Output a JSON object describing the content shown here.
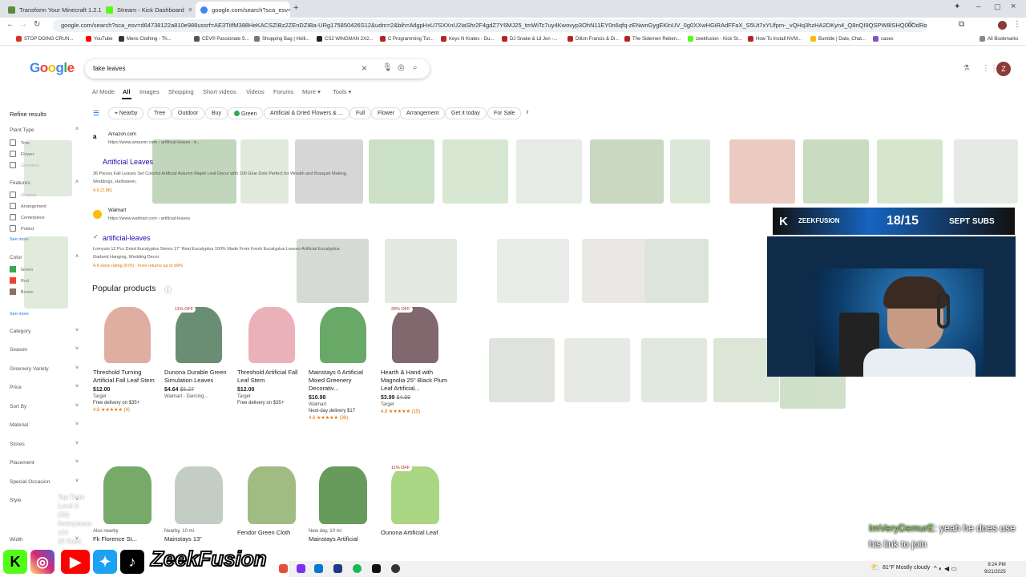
{
  "tabs": [
    {
      "title": "Transform Your Minecraft 1.2.1",
      "color": "#5b8c3a"
    },
    {
      "title": "Stream - Kick Dashboard",
      "color": "#53fc18"
    },
    {
      "title": "google.com/search?sca_esv=6",
      "color": "#4285f4"
    }
  ],
  "address": "google.com/search?sca_esv=d64738122a810e988ussrf=AE3TiIfM388HeKACSZIBz2ZEnDZIBa-URg175850426S12&udm=2&bih=AtlgpHxU7SXXnU2IaShr2F4gdZ7Y6MJ25_tmWiTc7uy4Kwovyp3OhN11EY0n6qfq-zENwnGygEKlnUV_0g0XXwHGiRAdFFaX_S5Ut7xYUfpm-_vQHq3hzHA2DKyn4_Q8nQI9QSPW8lSHQ00OdRq6rbhOAHpaPYKwplRXX",
  "bookmarks": [
    "STOP DOING CRUN...",
    "YouTube",
    "Mens Clothing - Th...",
    "CEV® Passionate S...",
    "Shopping Bag | Holli...",
    "CS2 WINGMAN 2X2...",
    "C Programming Tut...",
    "Keys N Krates - Du...",
    "DJ Snake & Lil Jon -...",
    "Dillon Francis & Di...",
    "The Sidemen Reben...",
    "zeekfusion - Kick St...",
    "How To Install NVM...",
    "Bumble | Date, Chat...",
    "cases",
    "All Bookmarks"
  ],
  "search": {
    "query": "fake leaves",
    "logo": "Google"
  },
  "search_tabs": [
    "AI Mode",
    "All",
    "Images",
    "Shopping",
    "Short videos",
    "Videos",
    "Forums",
    "More",
    "Tools"
  ],
  "chips": [
    "Nearby",
    "Tree",
    "Outdoor",
    "Buy",
    "Green",
    "Artificial & Dried Flowers & ...",
    "Full",
    "Flower",
    "Arrangement",
    "Get it today",
    "For Sale"
  ],
  "sidebar": {
    "title": "Refine results",
    "plant_type": "Plant Type",
    "plant_types": [
      "Tree",
      "Flower",
      "Greenery"
    ],
    "features": "Features",
    "feature_items": [
      "Outdoor",
      "Arrangement",
      "Centerpiece",
      "Potted"
    ],
    "see_more": "See more",
    "color": "Color",
    "colors": [
      {
        "name": "Green",
        "hex": "#34a853"
      },
      {
        "name": "Red",
        "hex": "#ea4335"
      },
      {
        "name": "Brown",
        "hex": "#8d6e63"
      }
    ],
    "see_more2": "See more",
    "sections": [
      "Category",
      "Season",
      "Greenery Variety",
      "Price",
      "Sort By",
      "Material",
      "Stores",
      "Placement",
      "Special Occasion",
      "Style",
      "Width"
    ]
  },
  "results": [
    {
      "source": "Amazon.com",
      "url": "https://www.amazon.com › artificial-leaves › b...",
      "title": "Artificial Leaves",
      "snippet": "36 Pieces Fall Leaves Set Colorful Artificial Autumn Maple Leaf Decor with 100 Glue Dots Perfect for Wreath and Bouquet Making, Weddings, Halloween,",
      "rating": "4.6 (2.9K)"
    },
    {
      "source": "Walmart",
      "url": "https://www.walmart.com › artificial-leaves",
      "title": "artificial-leaves",
      "snippet": "Lomyuio 12 Pcs Dried Eucalyptus Stems 17\" Real Eucalyptus 100% Made From Fresh Eucalyptus Leaves Artificial Eucalyptus Garland Hanging, Wedding Decor",
      "rating": "4.6 store rating (675) · Free returns up to 90%"
    }
  ],
  "popular": {
    "title": "Popular products",
    "items": [
      {
        "badge": "",
        "name": "Threshold Turning Artificial Fall Leaf Stem",
        "price": "$12.00",
        "old": "",
        "store": "Target",
        "extra": "Free delivery on $35+",
        "rating": "4.8 ★★★★★ (4)"
      },
      {
        "badge": "11% OFF",
        "name": "Dunona Durable Green Simulation Leaves",
        "price": "$4.64",
        "old": "$5.27",
        "store": "Walmart - Dancing...",
        "extra": "",
        "rating": ""
      },
      {
        "badge": "",
        "name": "Threshold Artificial Fall Leaf Stem",
        "price": "$12.00",
        "old": "",
        "store": "Target",
        "extra": "Free delivery on $35+",
        "rating": ""
      },
      {
        "badge": "",
        "name": "Mainstays 6 Artificial Mixed Greenery Decorativ...",
        "price": "$10.98",
        "old": "",
        "store": "Walmart",
        "extra": "Next-day delivery $17",
        "rating": "4.6 ★★★★★ (38)"
      },
      {
        "badge": "20% OFF",
        "name": "Hearth & Hand with Magnolia 25\" Black Plum Leaf Artificial...",
        "price": "$3.99",
        "old": "$4.99",
        "store": "Target",
        "extra": "",
        "rating": "4.8 ★★★★★ (15)"
      }
    ],
    "row2": [
      {
        "badge": "",
        "name": "Fk Florence St...",
        "store": "Also nearby"
      },
      {
        "badge": "",
        "name": "Mainstays 13\"",
        "store": "Nearby, 10 mi"
      },
      {
        "badge": "",
        "name": "Fendor Green Cloth",
        "store": ""
      },
      {
        "badge": "",
        "name": "Mainstays Artificial",
        "store": "New day, 10 mi"
      },
      {
        "badge": "11% OFF",
        "name": "Ounona Artificial Leaf",
        "store": ""
      }
    ]
  },
  "overlay": {
    "subs_brand": "ZEEKFUSION",
    "subs_count": "18/15",
    "subs_label": "SEPT SUBS",
    "chat_user": "ImVeryDemurE",
    "chat_msg": ": yeah he does use his link to join",
    "brand": "ZeekFusion",
    "train_line1": "Top Train",
    "train_line2": "Level 3 (30)",
    "train_line3": "Anonymous x14",
    "train_line4": "20 Subs"
  },
  "taskbar": {
    "weather": "81°F Mostly cloudy",
    "time": "9:24 PM",
    "date": "9/21/2025"
  },
  "colors": {
    "accent": "#1a73e8",
    "brand_green": "#53fc18",
    "link": "#1a0dab"
  }
}
